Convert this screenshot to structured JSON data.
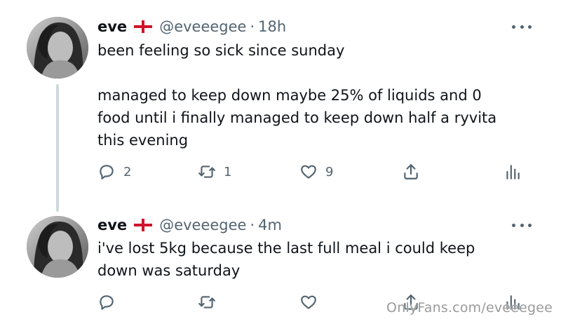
{
  "tweets": [
    {
      "display_name": "eve",
      "handle": "@eveeegee",
      "separator": "·",
      "time": "18h",
      "text_lines": [
        "been feeling so sick since sunday",
        "managed to keep down maybe 25% of liquids and 0",
        "food until i finally managed to keep down half a ryvita",
        "this evening"
      ],
      "reply_count": "2",
      "retweet_count": "1",
      "like_count": "9"
    },
    {
      "display_name": "eve",
      "handle": "@eveeegee",
      "separator": "·",
      "time": "4m",
      "text_lines": [
        "i've lost 5kg because the last full meal i could keep",
        "down was saturday"
      ],
      "reply_count": "",
      "retweet_count": "",
      "like_count": ""
    }
  ],
  "watermark": "OnlyFans.com/eveeegee",
  "icons": {
    "flag": "england-flag-icon",
    "more": "more-options-icon",
    "reply": "reply-icon",
    "retweet": "retweet-icon",
    "like": "heart-icon",
    "share": "share-icon",
    "analytics": "analytics-icon"
  },
  "colors": {
    "text": "#0f1419",
    "secondary": "#536471",
    "thread_line": "#cfd9de",
    "flag_red": "#cf142b"
  }
}
